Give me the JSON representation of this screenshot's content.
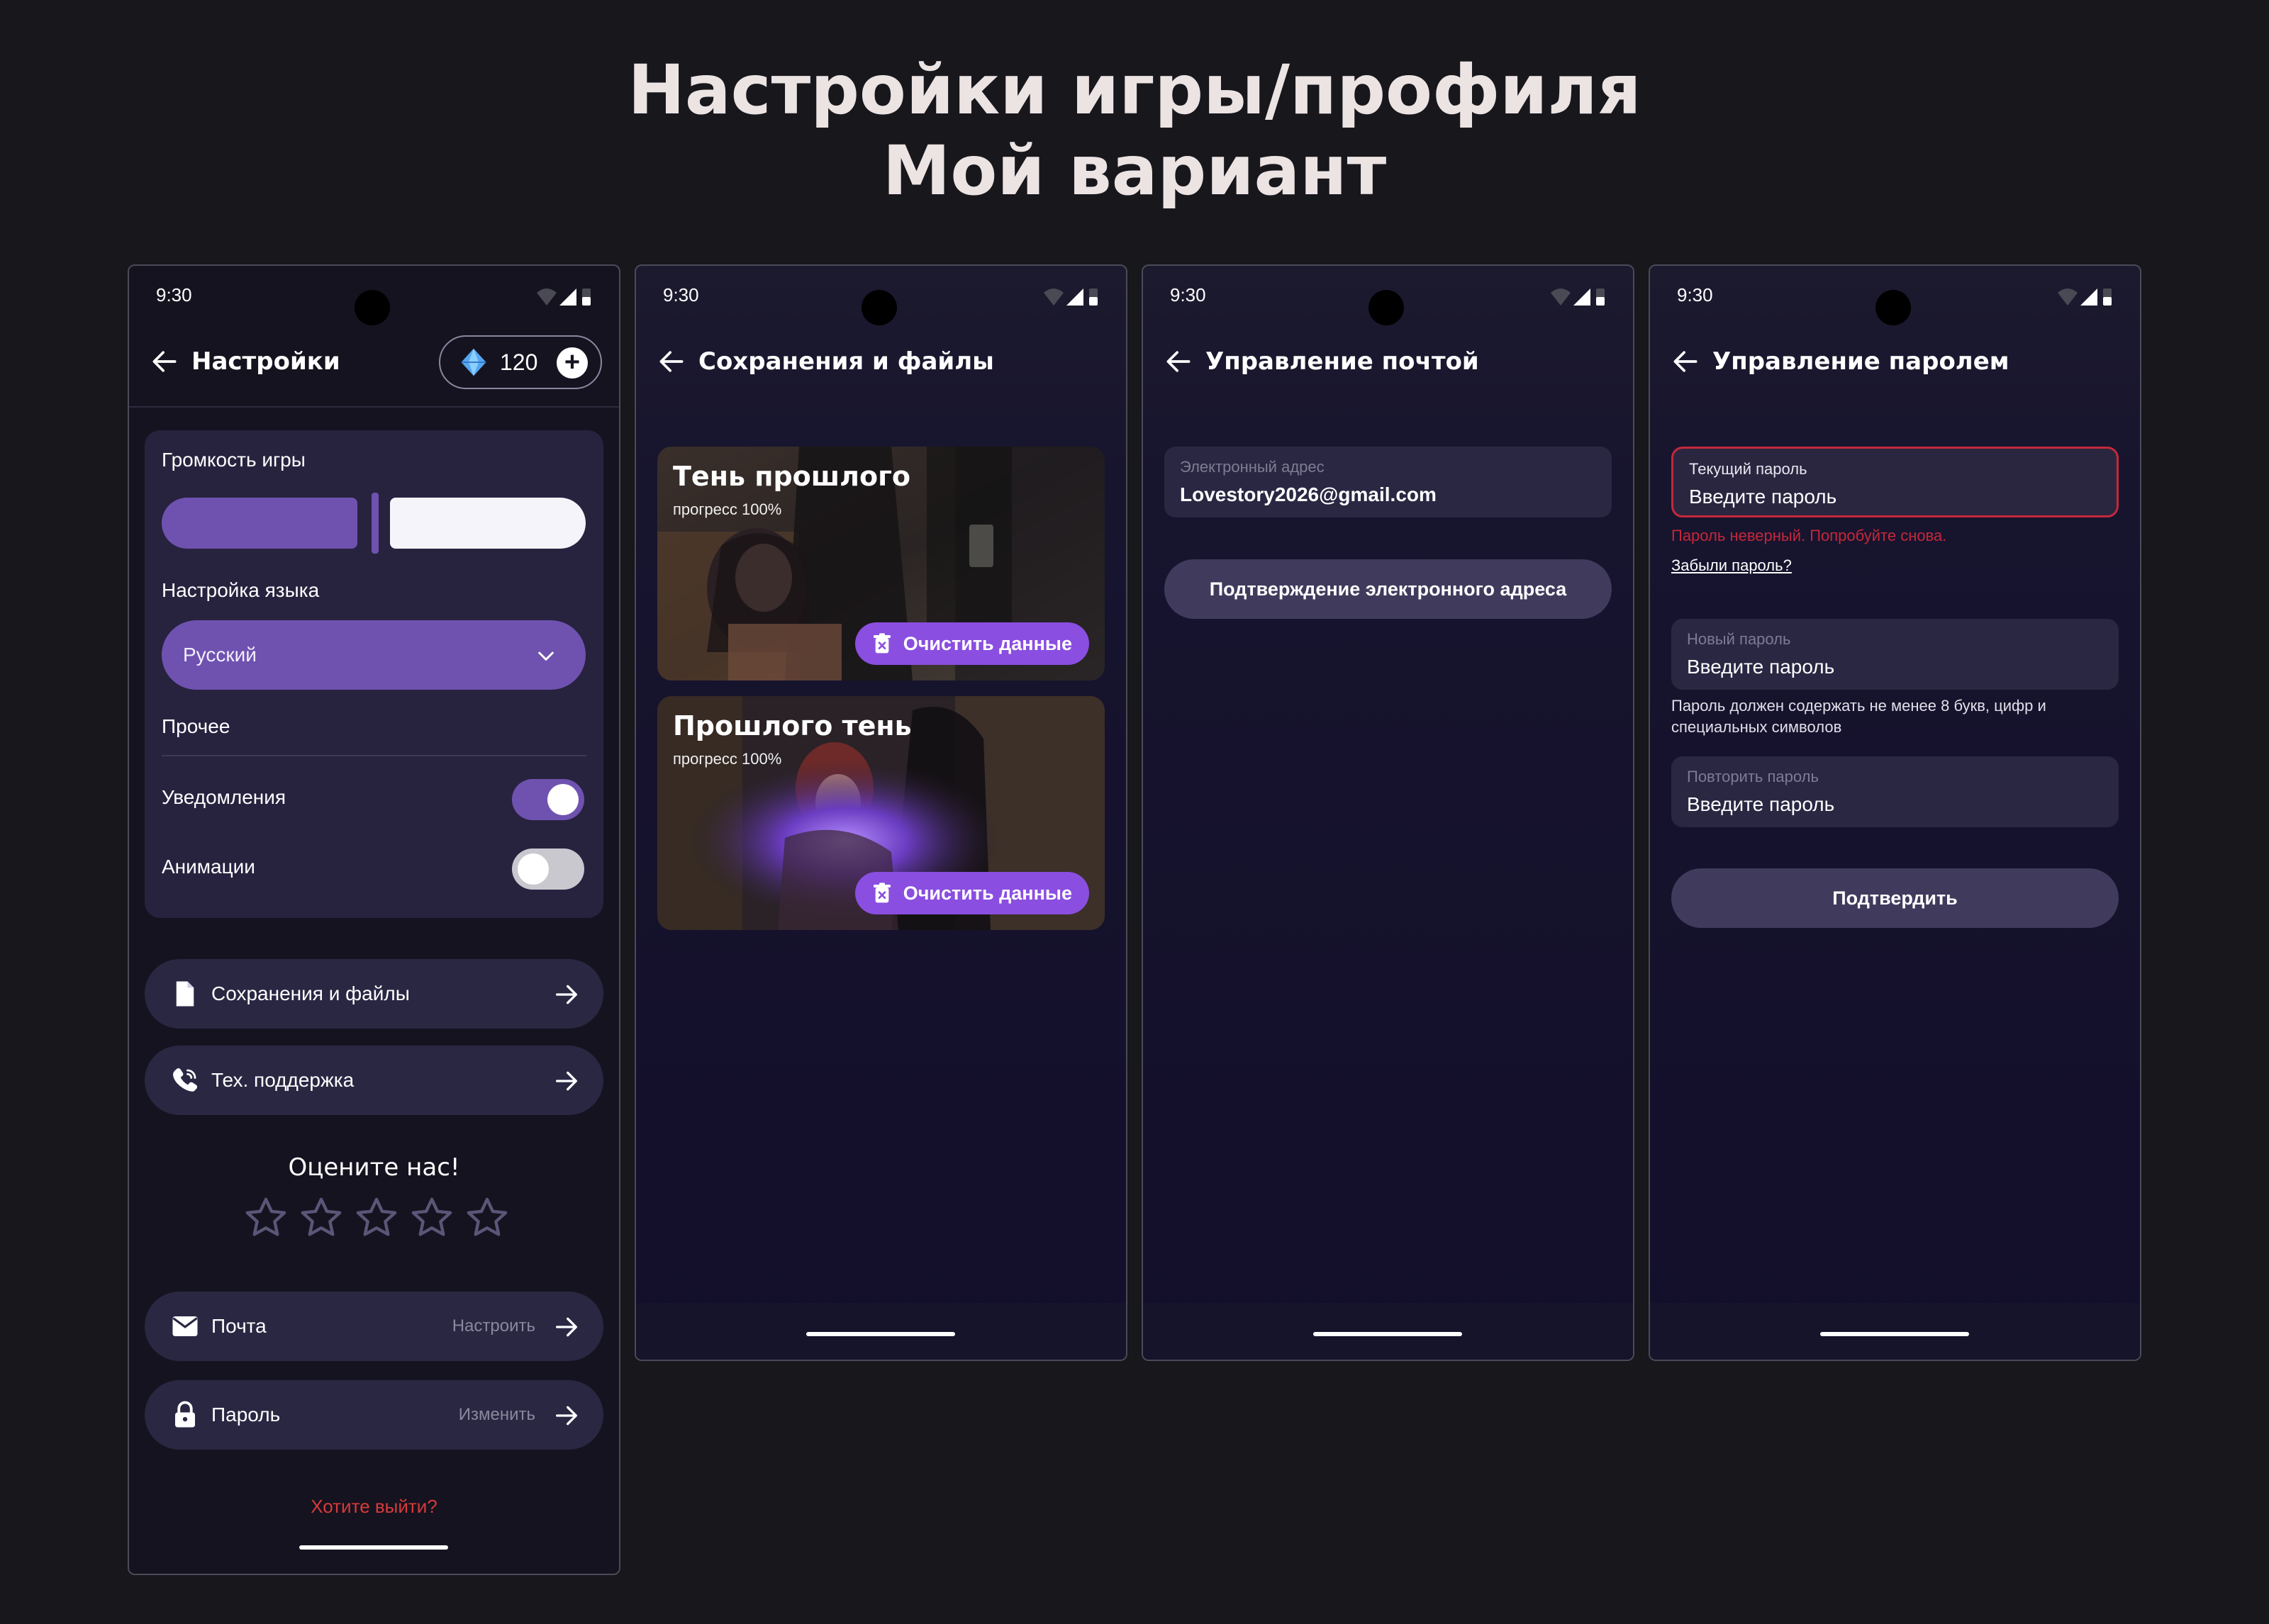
{
  "page": {
    "title_line1": "Настройки игры/профиля",
    "title_line2": "Мой вариант"
  },
  "status_bar": {
    "time": "9:30"
  },
  "settings_screen": {
    "title": "Настройки",
    "gems": "120",
    "volume_label": "Громкость игры",
    "volume_level": 0.5,
    "language_label": "Настройка языка",
    "language_value": "Русский",
    "other_label": "Прочее",
    "notifications_label": "Уведомления",
    "notifications_on": true,
    "animations_label": "Анимации",
    "animations_on": false,
    "saves_row": "Сохранения и файлы",
    "support_row": "Тех. поддержка",
    "rate_title": "Оцените нас!",
    "rating_value": 0,
    "rating_max": 5,
    "mail_row": "Почта",
    "mail_hint": "Настроить",
    "password_row": "Пароль",
    "password_hint": "Изменить",
    "logout": "Хотите выйти?"
  },
  "saves_screen": {
    "title": "Сохранения и файлы",
    "games": [
      {
        "title": "Тень прошлого",
        "progress": "прогресс 100%",
        "clear_label": "Очистить данные"
      },
      {
        "title": "Прошлого тень",
        "progress": "прогресс 100%",
        "clear_label": "Очистить данные"
      }
    ]
  },
  "email_screen": {
    "title": "Управление почтой",
    "field_label": "Электронный адрес",
    "field_value": "Lovestory2026@gmail.com",
    "confirm_button": "Подтверждение электронного адреса"
  },
  "password_screen": {
    "title": "Управление паролем",
    "current_label": "Текущий пароль",
    "current_placeholder": "Введите пароль",
    "error_text": "Пароль неверный. Попробуйте снова.",
    "forgot_link": "Забыли пароль?",
    "new_label": "Новый пароль",
    "new_placeholder": "Введите пароль",
    "hint_text": "Пароль должен содержать не менее 8 букв, цифр и специальных символов",
    "repeat_label": "Повторить пароль",
    "repeat_placeholder": "Введите пароль",
    "confirm_button": "Подтвердить"
  },
  "colors": {
    "background": "#17171c",
    "accent": "#6f52b0",
    "button_purple": "#8a4ee0",
    "error": "#c4283a",
    "logout_red": "#d83a3a"
  }
}
